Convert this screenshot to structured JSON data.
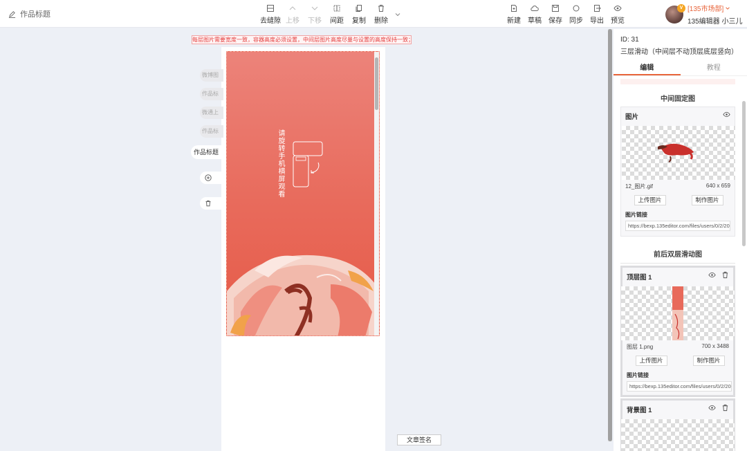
{
  "header": {
    "doc_title": "作品标题",
    "tools_center": [
      {
        "label": "去缝隙",
        "icon": "grid-icon",
        "disabled": false
      },
      {
        "label": "上移",
        "icon": "arrow-up-icon",
        "disabled": true
      },
      {
        "label": "下移",
        "icon": "arrow-down-icon",
        "disabled": true
      },
      {
        "label": "间距",
        "icon": "spacing-icon",
        "disabled": false
      },
      {
        "label": "复制",
        "icon": "copy-icon",
        "disabled": false
      },
      {
        "label": "删除",
        "icon": "trash-icon",
        "disabled": false
      }
    ],
    "tools_right": [
      {
        "label": "新建",
        "icon": "new-file-icon"
      },
      {
        "label": "草稿",
        "icon": "cloud-icon"
      },
      {
        "label": "保存",
        "icon": "save-icon"
      },
      {
        "label": "同步",
        "icon": "sync-icon"
      },
      {
        "label": "导出",
        "icon": "export-icon"
      },
      {
        "label": "预览",
        "icon": "eye-icon"
      }
    ],
    "user": {
      "market": "[135市场部]",
      "name": "135编辑器 小三儿",
      "vip_badge": "V"
    }
  },
  "canvas": {
    "notice": "每层图片需要宽度一致，容器高度必须设置，中间层图片高度尽量与设置的高度保持一致；",
    "rotate_hint": "请旋转手机横屏观看",
    "side_tabs": [
      "微博图",
      "作品标",
      "微通上",
      "作品标"
    ],
    "active_tab": "作品标题",
    "sign_button": "文章签名"
  },
  "panel": {
    "id_line": "ID: 31",
    "description": "三层滑动（中间层不动顶层底层竖向）",
    "tabs": [
      "编辑",
      "教程"
    ],
    "section_fixed": "中间固定图",
    "section_double": "前后双层滑动图",
    "cards": [
      {
        "title": "图片",
        "file": "12_图片.gif",
        "size": "640 x 659",
        "upload": "上传图片",
        "make": "制作图片",
        "link_label": "图片链接",
        "link": "https://bexp.135editor.com/files/users/0/2/20"
      },
      {
        "title": "顶层图 1",
        "file": "图层 1.png",
        "size": "700 x 3488",
        "upload": "上传图片",
        "make": "制作图片",
        "link_label": "图片链接",
        "link": "https://bexp.135editor.com/files/users/0/2/20"
      },
      {
        "title": "背景图 1"
      }
    ]
  },
  "colors": {
    "accent": "#e8643a",
    "notice_red": "#e43d3d",
    "phone_bg": "#e86a5b"
  }
}
